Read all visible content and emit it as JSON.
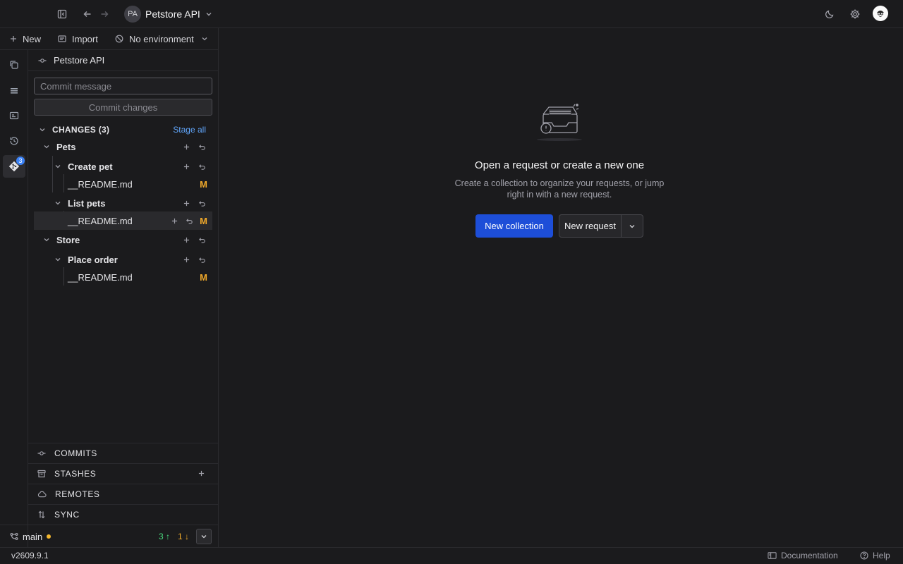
{
  "header": {
    "project_initials": "PA",
    "project_name": "Petstore API"
  },
  "toolbar": {
    "new_label": "New",
    "import_label": "Import",
    "environment_label": "No environment"
  },
  "activity": {
    "git_badge": "3"
  },
  "git_panel": {
    "title": "Petstore API",
    "commit_placeholder": "Commit message",
    "commit_button": "Commit changes",
    "changes_label": "CHANGES (3)",
    "stage_all": "Stage all",
    "tree": {
      "pets": "Pets",
      "create_pet": "Create pet",
      "readme_1": "__README.md",
      "list_pets": "List pets",
      "readme_2": "__README.md",
      "store": "Store",
      "place_order": "Place order",
      "readme_3": "__README.md"
    },
    "modified_marker": "M",
    "sections": {
      "commits": "COMMITS",
      "stashes": "STASHES",
      "remotes": "REMOTES",
      "sync": "SYNC"
    }
  },
  "branch": {
    "name": "main",
    "ahead": "3 ↑",
    "behind": "1 ↓"
  },
  "empty_state": {
    "title": "Open a request or create a new one",
    "description": "Create a collection to organize your requests, or jump right in with a new request.",
    "primary_button": "New collection",
    "secondary_button": "New request"
  },
  "statusbar": {
    "version": "v2609.9.1",
    "documentation": "Documentation",
    "help": "Help"
  },
  "colors": {
    "accent": "#1d4ed8",
    "modified": "#f0a92b",
    "ahead": "#4ade80",
    "link": "#60a5fa"
  }
}
